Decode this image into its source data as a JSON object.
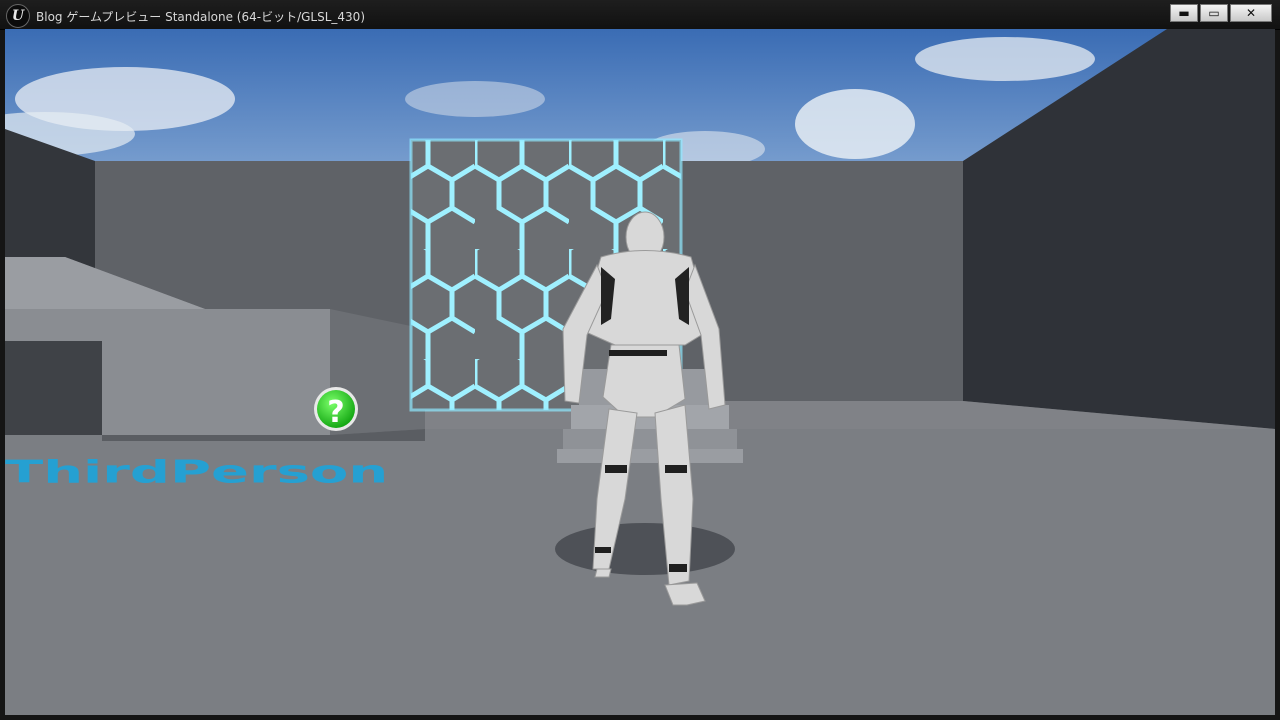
{
  "window": {
    "title": "Blog ゲームプレビュー Standalone (64-ビット/GLSL_430)",
    "icon": "unreal-engine-logo",
    "logo_text": "U",
    "controls": {
      "minimize_glyph": "▬",
      "maximize_glyph": "▭",
      "close_glyph": "✕"
    }
  },
  "scene": {
    "floor_text": "ThirdPerson",
    "help_glyph": "?",
    "colors": {
      "sky_top": "#3f6fb3",
      "floor": "#7b7e83",
      "wall": "#5f6267",
      "dark_wall": "#2f3238",
      "hex_glow": "#8fe8ff",
      "floor_text": "#17a7e0",
      "help_icon": "#2bd62b"
    }
  }
}
